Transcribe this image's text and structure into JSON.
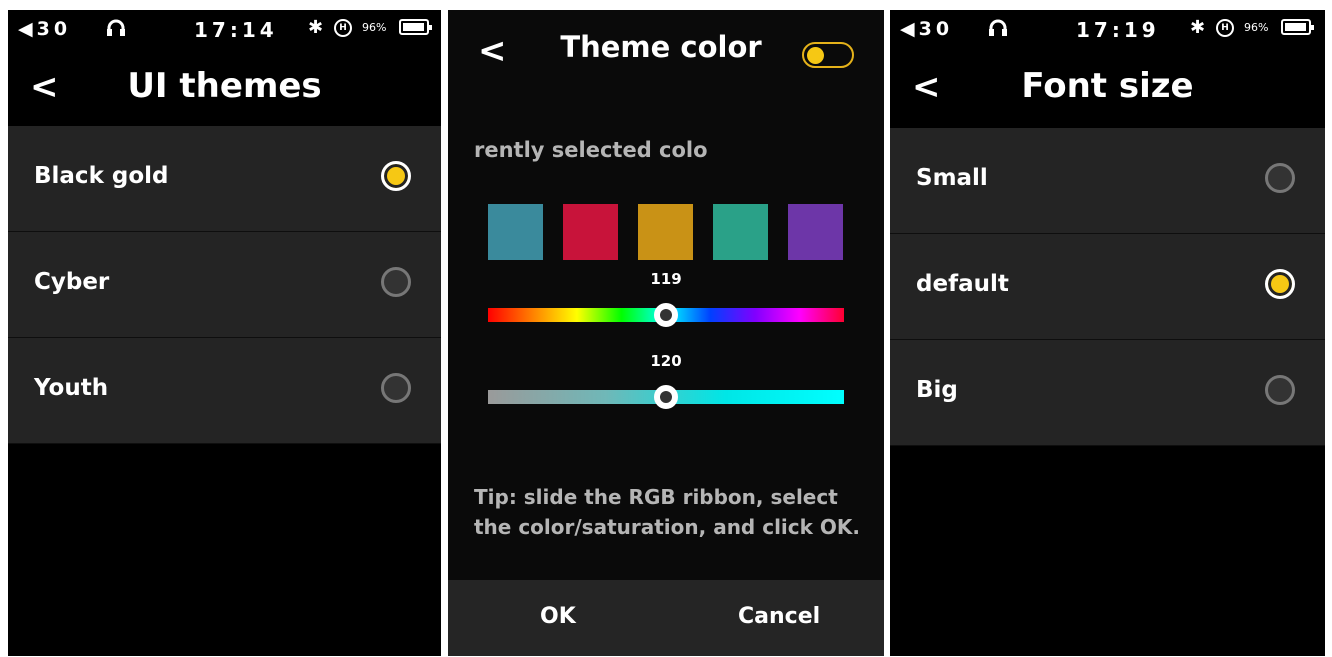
{
  "status_left": {
    "volume": "30",
    "time": "17:14",
    "battery": "96%"
  },
  "status_right": {
    "volume": "30",
    "time": "17:19",
    "battery": "96%"
  },
  "ui_themes": {
    "back": "<",
    "title": "UI themes",
    "items": [
      {
        "label": "Black gold",
        "selected": true
      },
      {
        "label": "Cyber",
        "selected": false
      },
      {
        "label": "Youth",
        "selected": false
      }
    ]
  },
  "theme_color": {
    "back": "<",
    "title": "Theme color",
    "toggle_on": true,
    "subtitle": "rently selected colo",
    "swatches": [
      "#3a8a9c",
      "#c8133a",
      "#c99216",
      "#2aa188",
      "#6d36a8"
    ],
    "hue_value": "119",
    "hue_fraction": 0.5,
    "saturation_value": "120",
    "saturation_fraction": 0.5,
    "tip": "Tip: slide the RGB ribbon, select the color/saturation, and click OK.",
    "ok_label": "OK",
    "cancel_label": "Cancel"
  },
  "font_size": {
    "back": "<",
    "title": "Font size",
    "items": [
      {
        "label": "Small",
        "selected": false
      },
      {
        "label": "default",
        "selected": true
      },
      {
        "label": "Big",
        "selected": false
      }
    ]
  },
  "accent": "#f6c814"
}
